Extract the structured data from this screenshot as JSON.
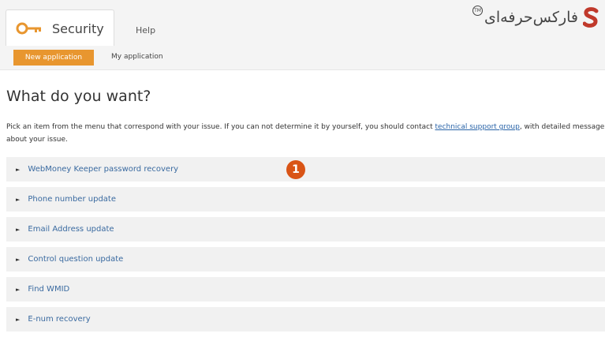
{
  "nav": {
    "tab_security": "Security",
    "tab_help": "Help",
    "new_application": "New application",
    "my_application": "My application"
  },
  "logo": {
    "text": "فارکس‌حرفه‌ای",
    "tm": "TM"
  },
  "main": {
    "title": "What do you want?",
    "intro_before": "Pick an item from the menu that correspond with your issue. If you can not determine it by yourself, you should contact ",
    "intro_link": "technical support group",
    "intro_after": ", with detailed message about your issue.",
    "menu": [
      {
        "label": "WebMoney Keeper password recovery"
      },
      {
        "label": "Phone number update"
      },
      {
        "label": "Email Address update"
      },
      {
        "label": "Control question update"
      },
      {
        "label": "Find WMID"
      },
      {
        "label": "E-num recovery"
      }
    ]
  },
  "annotation": {
    "step": "1"
  },
  "colors": {
    "accent_orange": "#e8962f",
    "badge_red": "#d95416",
    "link_blue": "#2a64a8",
    "menu_bg": "#f1f1f1"
  },
  "icons": {
    "security_tab": "key-icon",
    "menu_item": "triangle-right-icon",
    "logo": "s-logo-icon"
  }
}
